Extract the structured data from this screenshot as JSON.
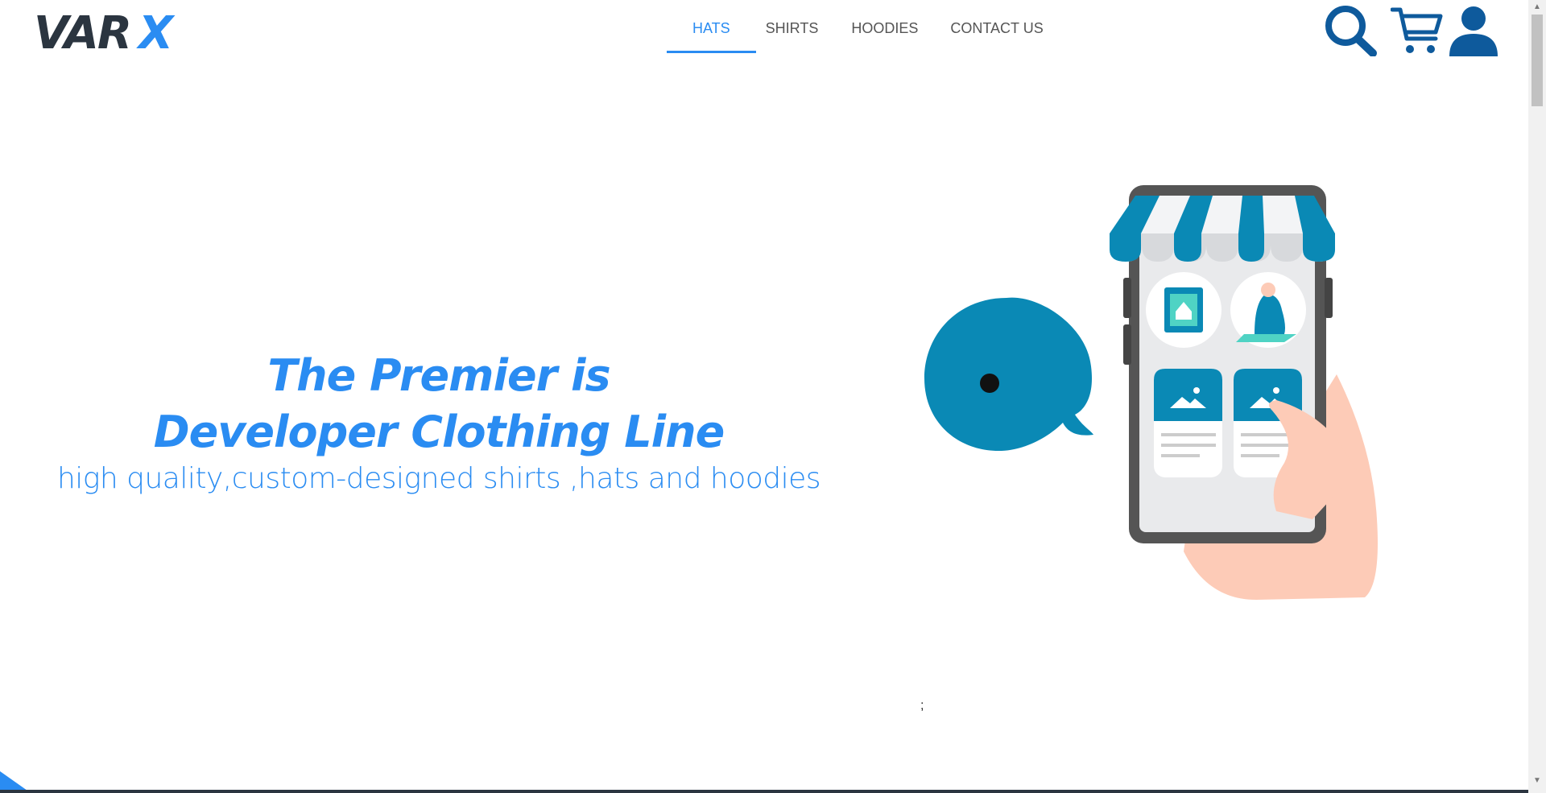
{
  "logo": {
    "var": "VAR",
    "x": "X"
  },
  "nav": {
    "items": [
      {
        "label": "HATS",
        "active": true
      },
      {
        "label": "SHIRTS",
        "active": false
      },
      {
        "label": "HOODIES",
        "active": false
      },
      {
        "label": "CONTACT US",
        "active": false
      }
    ]
  },
  "header_icons": [
    "search-icon",
    "cart-icon",
    "user-icon"
  ],
  "hero": {
    "title_line1": "The Premier is",
    "title_line2": "Developer Clothing Line",
    "subtitle": "high quality,custom-designed shirts ,hats and hoodies"
  },
  "stray_text": ";",
  "colors": {
    "accent": "#2a8cf2",
    "dark": "#2b3540",
    "illustration": "#0a89b5",
    "icon": "#0e5a9c"
  }
}
